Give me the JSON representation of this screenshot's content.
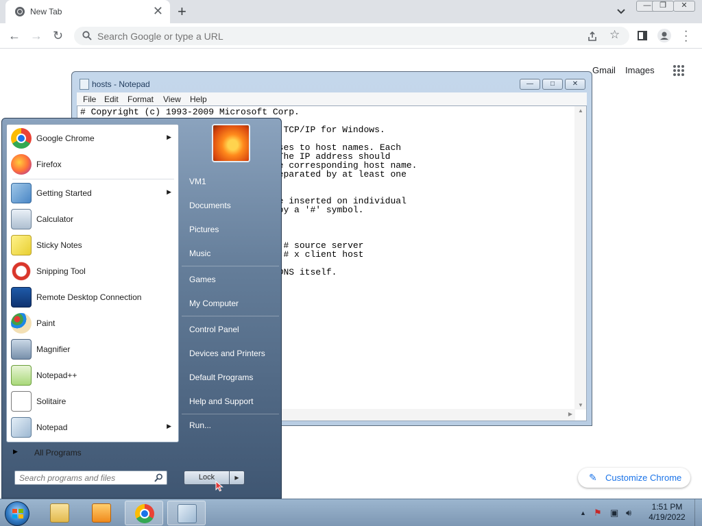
{
  "browser": {
    "tab_title": "New Tab",
    "tab_close": "✕",
    "new_tab": "+",
    "search_placeholder": "Search Google or type a URL",
    "gmail": "Gmail",
    "images": "Images",
    "customize": "Customize Chrome",
    "window_controls": [
      "—",
      "❐",
      "✕"
    ]
  },
  "notepad": {
    "title": "hosts - Notepad",
    "controls": [
      "—",
      "□",
      "✕"
    ],
    "menu": [
      "File",
      "Edit",
      "Format",
      "View",
      "Help"
    ],
    "lines": [
      "# Copyright (c) 1993-2009 Microsoft Corp.",
      "                            Microsoft TCP/IP for Windows.",
      "                            IP addresses to host names. Each",
      "                            al line. The IP address should",
      "                            wed by the corresponding host name.",
      "                            ould be separated by at least one",
      "                            se) may be inserted on individual",
      "                             denoted by a '#' symbol.",
      "                            m         # source server",
      "                                      # x client host",
      "                            d within DNS itself."
    ]
  },
  "start_menu": {
    "programs": [
      {
        "label": "Google Chrome",
        "icon": "chrome-icon",
        "submenu": true
      },
      {
        "label": "Firefox",
        "icon": "firefox-icon",
        "submenu": false
      },
      {
        "label": "Getting Started",
        "icon": "getting-started-icon",
        "submenu": true
      },
      {
        "label": "Calculator",
        "icon": "calculator-icon",
        "submenu": false
      },
      {
        "label": "Sticky Notes",
        "icon": "sticky-notes-icon",
        "submenu": false
      },
      {
        "label": "Snipping Tool",
        "icon": "snipping-tool-icon",
        "submenu": false
      },
      {
        "label": "Remote Desktop Connection",
        "icon": "remote-desktop-icon",
        "submenu": false
      },
      {
        "label": "Paint",
        "icon": "paint-icon",
        "submenu": false
      },
      {
        "label": "Magnifier",
        "icon": "magnifier-icon",
        "submenu": false
      },
      {
        "label": "Notepad++",
        "icon": "notepad-plus-plus-icon",
        "submenu": false
      },
      {
        "label": "Solitaire",
        "icon": "solitaire-icon",
        "submenu": false
      },
      {
        "label": "Notepad",
        "icon": "notepad-icon",
        "submenu": true
      }
    ],
    "all_programs": "All Programs",
    "search_placeholder": "Search programs and files",
    "places": [
      "VM1",
      "Documents",
      "Pictures",
      "Music",
      "Games",
      "My Computer",
      "Control Panel",
      "Devices and Printers",
      "Default Programs",
      "Help and Support",
      "Run..."
    ],
    "lock": "Lock"
  },
  "taskbar": {
    "time": "1:51 PM",
    "date": "4/19/2022",
    "pinned": [
      "explorer-icon",
      "media-player-icon",
      "chrome-icon",
      "notepad-icon"
    ]
  },
  "colors": {
    "chrome_blue": "#1a73e8",
    "chrome_red": "#ea4335",
    "chrome_yellow": "#fbbc05",
    "chrome_green": "#34a853"
  }
}
